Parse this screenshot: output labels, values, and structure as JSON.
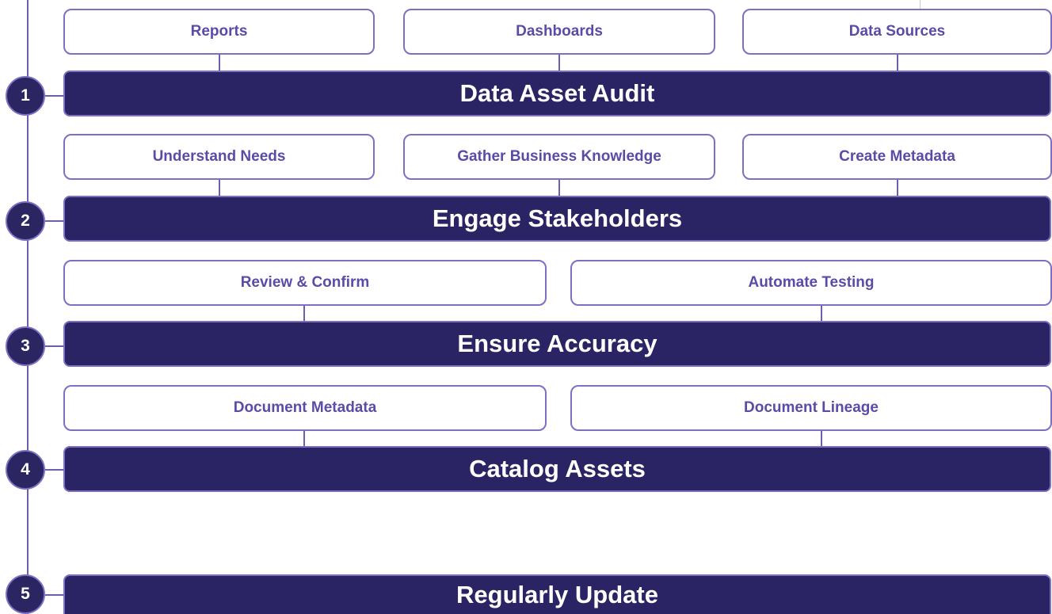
{
  "stages": [
    {
      "number": "1",
      "title": "Data Asset Audit",
      "tasks": [
        "Reports",
        "Dashboards",
        "Data Sources"
      ]
    },
    {
      "number": "2",
      "title": "Engage Stakeholders",
      "tasks": [
        "Understand Needs",
        "Gather Business Knowledge",
        "Create Metadata"
      ]
    },
    {
      "number": "3",
      "title": "Ensure Accuracy",
      "tasks": [
        "Review & Confirm",
        "Automate Testing"
      ]
    },
    {
      "number": "4",
      "title": "Catalog Assets",
      "tasks": [
        "Document Metadata",
        "Document Lineage"
      ]
    },
    {
      "number": "5",
      "title": "Regularly Update",
      "tasks": []
    }
  ],
  "colors": {
    "stage_fill": "#2a2464",
    "border": "#7b70c4",
    "task_text": "#5b4ba8",
    "connector": "#6a5fb0"
  }
}
